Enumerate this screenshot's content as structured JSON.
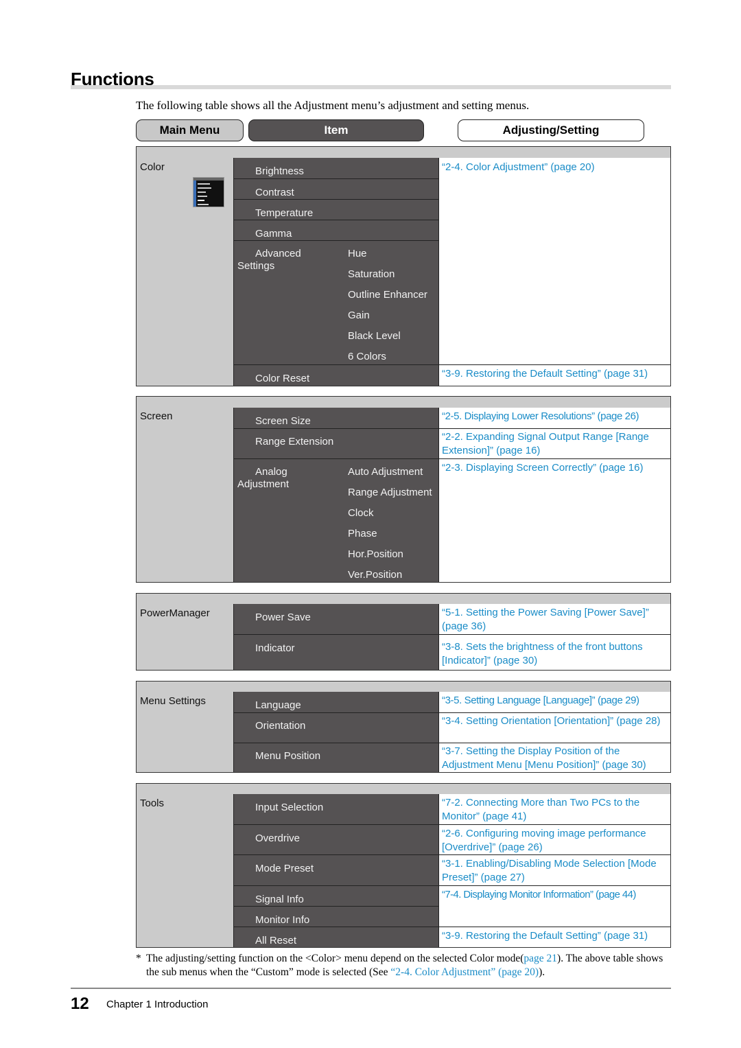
{
  "page": {
    "title": "Functions",
    "intro": "The following table shows all the Adjustment menu’s adjustment and setting menus.",
    "page_number": "12",
    "chapter": "Chapter 1  Introduction"
  },
  "headers": {
    "main_menu": "Main Menu",
    "item": "Item",
    "adjusting": "Adjusting/Setting"
  },
  "colors": {
    "link": "#1a8cc7",
    "item_bg": "#555253",
    "main_bg": "#cbcbcb"
  },
  "sections": {
    "color": {
      "label": "Color",
      "icon": "osd-menu-thumbnail-icon",
      "items": [
        "Brightness",
        "Contrast",
        "Temperature",
        "Gamma",
        "Advanced Settings",
        "Color Reset"
      ],
      "advanced_sub": [
        "Hue",
        "Saturation",
        "Outline Enhancer",
        "Gain",
        "Black Level",
        "6 Colors"
      ],
      "links": [
        "“2-4. Color Adjustment” (page 20)",
        "“3-9. Restoring the Default Setting” (page 31)"
      ]
    },
    "screen": {
      "label": "Screen",
      "items": [
        "Screen Size",
        "Range Extension",
        "Analog Adjustment"
      ],
      "analog_sub": [
        "Auto Adjustment",
        "Range Adjustment",
        "Clock",
        "Phase",
        "Hor.Position",
        "Ver.Position"
      ],
      "links": [
        "“2-5. Displaying Lower Resolutions” (page 26)",
        "“2-2. Expanding Signal Output Range [Range Extension]” (page 16)",
        "“2-3. Displaying Screen Correctly” (page 16)"
      ]
    },
    "power": {
      "label": "PowerManager",
      "items": [
        "Power Save",
        "Indicator"
      ],
      "links": [
        "“5-1. Setting the Power Saving [Power Save]” (page 36)",
        "“3-8. Sets the brightness of the front buttons [Indicator]” (page 30)"
      ]
    },
    "menu": {
      "label": "Menu Settings",
      "items": [
        "Language",
        "Orientation",
        "Menu Position"
      ],
      "links": [
        "“3-5. Setting Language [Language]” (page 29)",
        "“3-4. Setting Orientation [Orientation]” (page 28)",
        "“3-7. Setting the Display Position of the Adjustment Menu [Menu Position]” (page 30)"
      ]
    },
    "tools": {
      "label": "Tools",
      "items": [
        "Input Selection",
        "Overdrive",
        "Mode Preset",
        "Signal Info",
        "Monitor Info",
        "All Reset"
      ],
      "links": [
        "“7-2. Connecting More than Two PCs to the Monitor” (page 41)",
        "“2-6. Configuring moving image performance [Overdrive]” (page 26)",
        "“3-1. Enabling/Disabling Mode Selection [Mode Preset]” (page 27)",
        "“7-4. Displaying Monitor Information” (page 44)",
        "“3-9. Restoring the Default Setting” (page 31)"
      ]
    }
  },
  "footnote": {
    "star": "*",
    "part1": "The adjusting/setting function on the <Color> menu depend on the selected Color mode(",
    "link1": "page 21",
    "part2": "). The above table shows the sub menus when the “Custom” mode is selected (See ",
    "link2": "“2-4. Color Adjustment” (page 20)",
    "part3": ")."
  }
}
